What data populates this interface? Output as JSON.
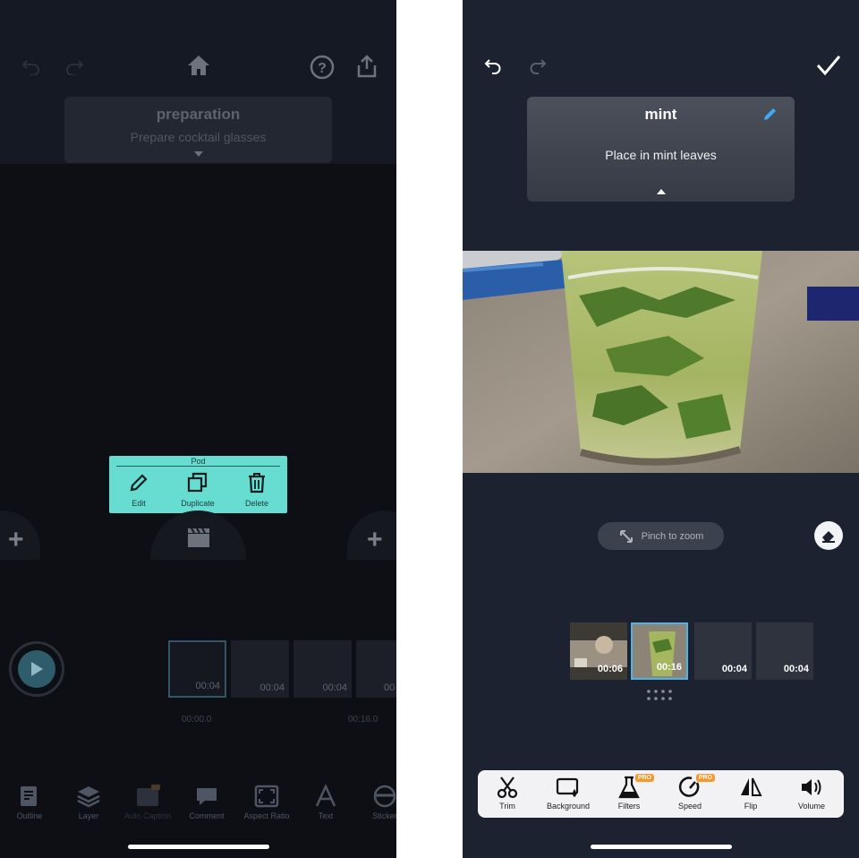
{
  "left_screen": {
    "card": {
      "title": "preparation",
      "description": "Prepare cocktail glasses"
    },
    "pod_menu": {
      "title": "Pod",
      "items": [
        {
          "label": "Edit",
          "icon": "pencil-icon"
        },
        {
          "label": "Duplicate",
          "icon": "duplicate-icon"
        },
        {
          "label": "Delete",
          "icon": "trash-icon"
        }
      ]
    },
    "clips": [
      "00:04",
      "00:04",
      "00:04",
      "00"
    ],
    "timestamps": {
      "start": "00:00.0",
      "mid": "00:16.0"
    },
    "toolbar": [
      {
        "label": "Outline",
        "icon": "outline-icon"
      },
      {
        "label": "Layer",
        "icon": "layers-icon"
      },
      {
        "label": "Auto Caption",
        "icon": "auto-caption-icon"
      },
      {
        "label": "Comment",
        "icon": "comment-icon"
      },
      {
        "label": "Aspect Ratio",
        "icon": "aspect-ratio-icon"
      },
      {
        "label": "Text",
        "icon": "text-icon"
      },
      {
        "label": "Sticker",
        "icon": "sticker-icon"
      }
    ]
  },
  "right_screen": {
    "card": {
      "title": "mint",
      "description": "Place in mint leaves"
    },
    "pinch_hint": "Pinch to zoom",
    "clips": [
      {
        "time": "00:06"
      },
      {
        "time": "00:16"
      },
      {
        "time": "00:04"
      },
      {
        "time": "00:04"
      }
    ],
    "toolbar": [
      {
        "label": "Trim",
        "icon": "scissors-icon"
      },
      {
        "label": "Background",
        "icon": "background-icon"
      },
      {
        "label": "Filters",
        "icon": "filters-icon",
        "badge": "PRO"
      },
      {
        "label": "Speed",
        "icon": "speed-icon",
        "badge": "PRO"
      },
      {
        "label": "Flip",
        "icon": "flip-icon"
      },
      {
        "label": "Volume",
        "icon": "volume-icon"
      }
    ]
  },
  "colors": {
    "accent_teal": "#66ddd0",
    "pencil_blue": "#3fa9f5",
    "pro_orange": "#f39a2c",
    "selected_clip_border": "#4fb3e6"
  }
}
